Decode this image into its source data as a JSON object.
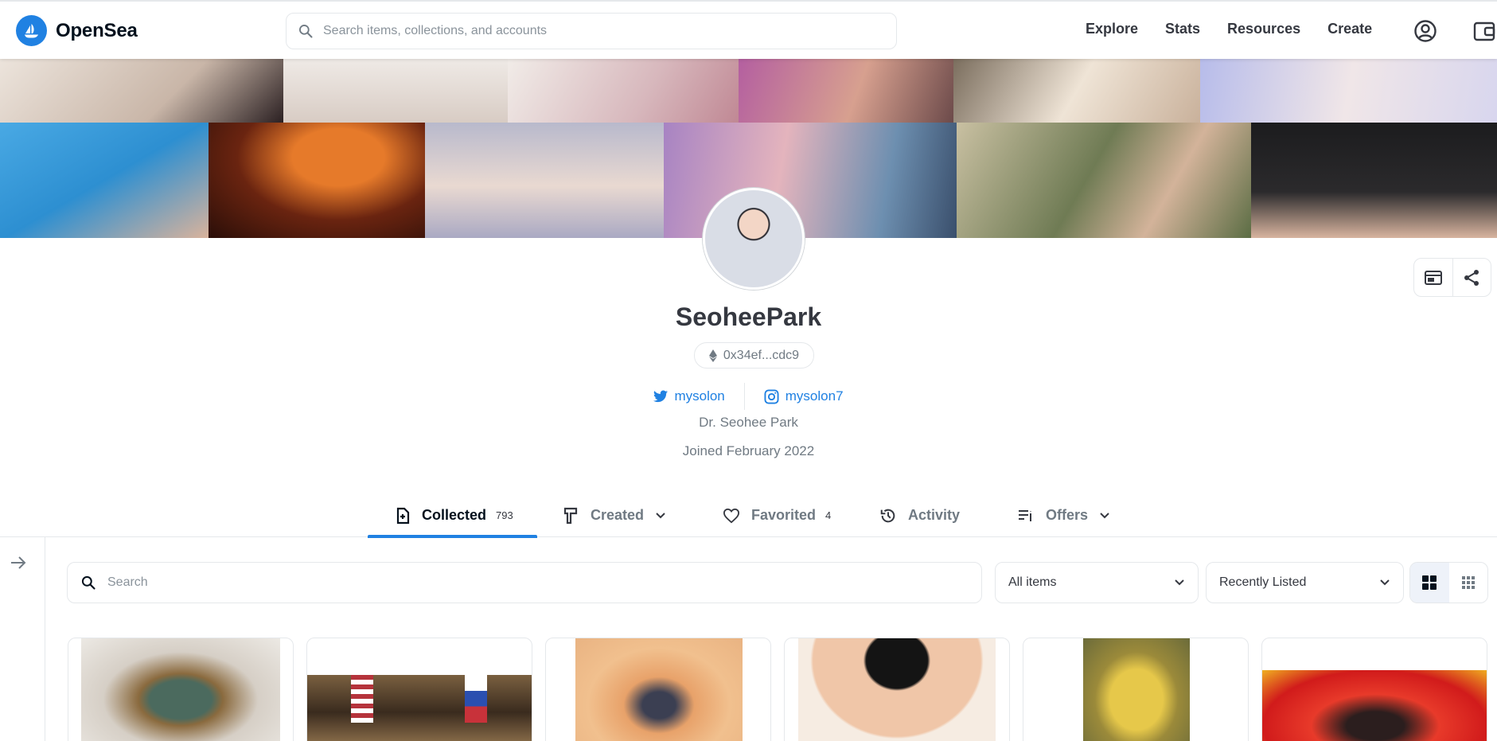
{
  "brand": {
    "name": "OpenSea",
    "accent": "#2081e2"
  },
  "header": {
    "search_placeholder": "Search items, collections, and accounts",
    "nav": [
      {
        "label": "Explore"
      },
      {
        "label": "Stats"
      },
      {
        "label": "Resources"
      },
      {
        "label": "Create"
      }
    ],
    "icons": [
      "account-icon",
      "wallet-icon"
    ]
  },
  "profile": {
    "username": "SeoheePark",
    "address": "0x34ef...cdc9",
    "twitter": "mysolon",
    "instagram": "mysolon7",
    "bio": "Dr. Seohee Park",
    "joined": "Joined February 2022"
  },
  "tabs": [
    {
      "label": "Collected",
      "count": "793",
      "icon": "collected-icon",
      "active": true
    },
    {
      "label": "Created",
      "count": "",
      "icon": "created-icon",
      "dropdown": true
    },
    {
      "label": "Favorited",
      "count": "4",
      "icon": "heart-icon"
    },
    {
      "label": "Activity",
      "count": "",
      "icon": "history-icon"
    },
    {
      "label": "Offers",
      "count": "",
      "icon": "offers-icon",
      "dropdown": true
    }
  ],
  "filters": {
    "search_placeholder": "Search",
    "items_select": "All items",
    "sort_select": "Recently Listed"
  }
}
